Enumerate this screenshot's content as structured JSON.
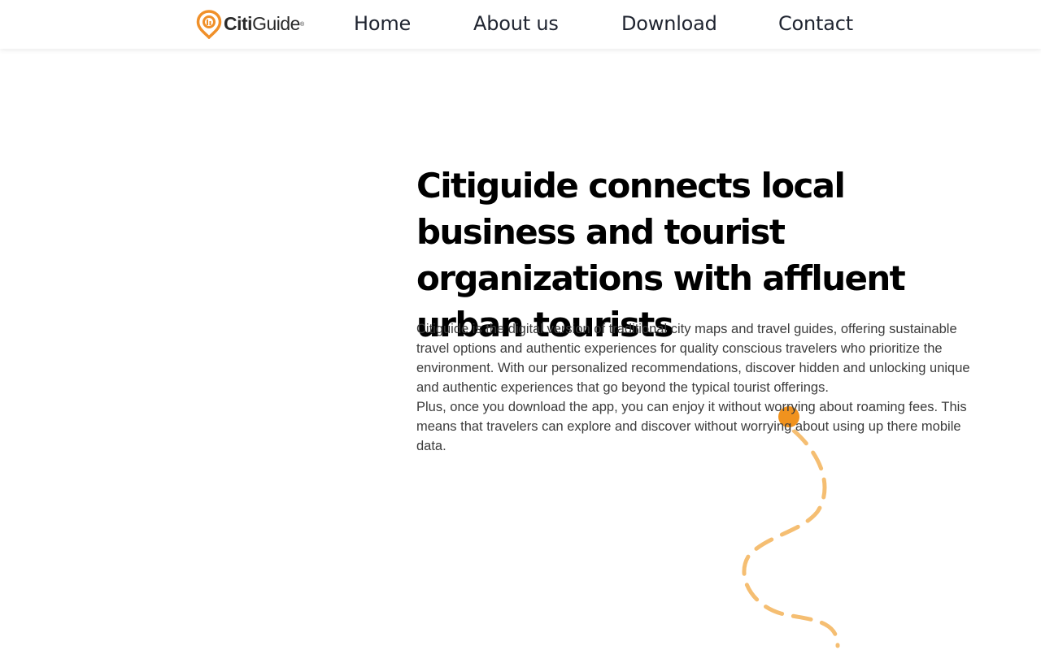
{
  "brand": {
    "logo_bold": "Citi",
    "logo_light": "Guide",
    "logo_mark": "®",
    "accent_color": "#f0902a",
    "logo_icon": "map-pin-icon"
  },
  "nav": {
    "items": [
      {
        "label": "Home"
      },
      {
        "label": "About us"
      },
      {
        "label": "Download"
      },
      {
        "label": "Contact"
      }
    ]
  },
  "hero": {
    "title": "Citiguide connects local business and tourist organizations with affluent urban tourists",
    "paragraph_1": "Citiguide is the digital version of traditional city maps and travel guides, offering sustainable travel options and authentic experiences for quality conscious travelers who prioritize the environment. With our personalized recommendations, discover hidden and unlocking unique and authentic experiences that go beyond the typical tourist offerings.",
    "paragraph_2": "Plus, once you download the app, you can enjoy it without worrying about roaming fees. This means that travelers can explore and discover without worrying about using up there mobile data."
  },
  "decoration": {
    "route_icon": "dashed-route-path",
    "route_color": "#f5be72",
    "dot_color": "#f0921e"
  }
}
